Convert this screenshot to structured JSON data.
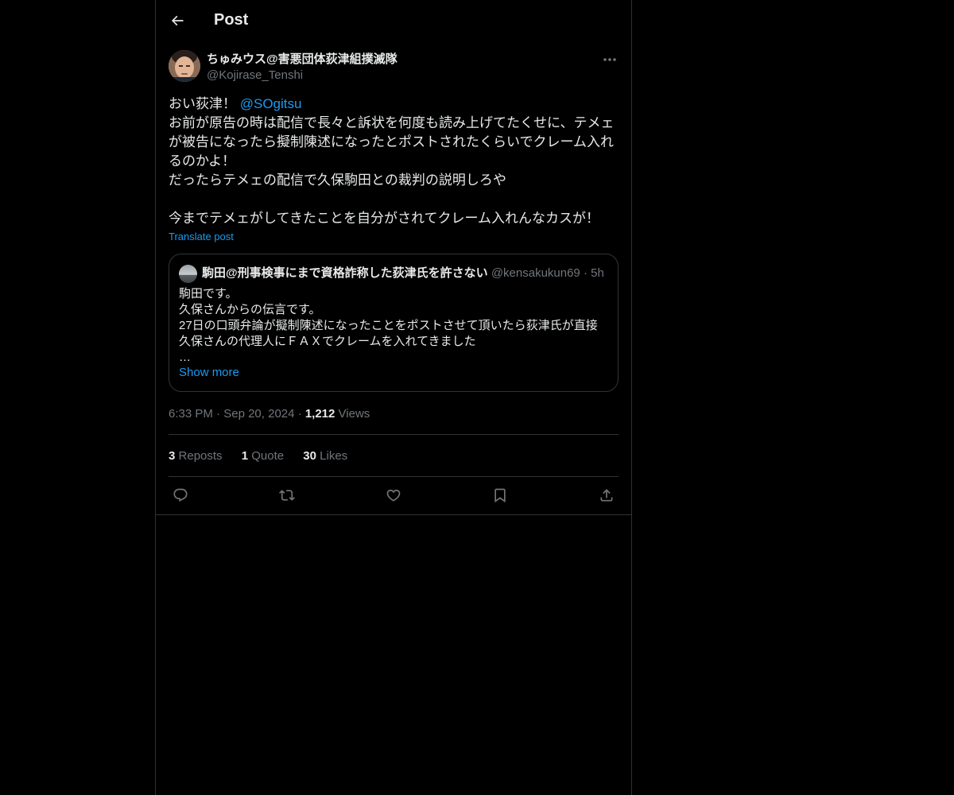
{
  "header": {
    "title": "Post",
    "back_icon": "arrow-left-icon"
  },
  "post": {
    "display_name": "ちゅみウス@害悪団体荻津組撲滅隊",
    "handle": "@Kojirase_Tenshi",
    "text": {
      "line1_prefix": "おい荻津！ ",
      "line1_mention": "@SOgitsu",
      "line2": "お前が原告の時は配信で長々と訴状を何度も読み上げてたくせに、テメェ",
      "line3": "が被告になったら擬制陳述になったとポストされたくらいでクレーム入れ",
      "line4": "るのかよ！",
      "line5": "だったらテメェの配信で久保駒田との裁判の説明しろや",
      "line6": "今までテメェがしてきたことを自分がされてクレーム入れんなカスが！"
    },
    "translate_label": "Translate post",
    "quote": {
      "display_name": "駒田@刑事検事にまで資格詐称した荻津氏を許さない",
      "handle": "@kensakukun69",
      "separator": "·",
      "time": "5h",
      "lines": [
        "駒田です。",
        "久保さんからの伝言です。",
        "27日の口頭弁論が擬制陳述になったことをポストさせて頂いたら荻津氏が直接",
        "久保さんの代理人にＦＡＸでクレームを入れてきました",
        "…"
      ],
      "show_more": "Show more"
    },
    "meta": {
      "time": "6:33 PM",
      "sep1": "·",
      "date": "Sep 20, 2024",
      "sep2": "·",
      "views_count": "1,212",
      "views_label": "Views"
    },
    "stats": {
      "reposts_count": "3",
      "reposts_label": "Reposts",
      "quotes_count": "1",
      "quotes_label": "Quote",
      "likes_count": "30",
      "likes_label": "Likes"
    },
    "actions": [
      "reply-icon",
      "repost-icon",
      "like-icon",
      "bookmark-icon",
      "share-icon"
    ]
  },
  "colors": {
    "background": "#000000",
    "text": "#e7e9ea",
    "secondary_text": "#71767b",
    "accent": "#1d9bf0",
    "border": "#2f3336"
  }
}
